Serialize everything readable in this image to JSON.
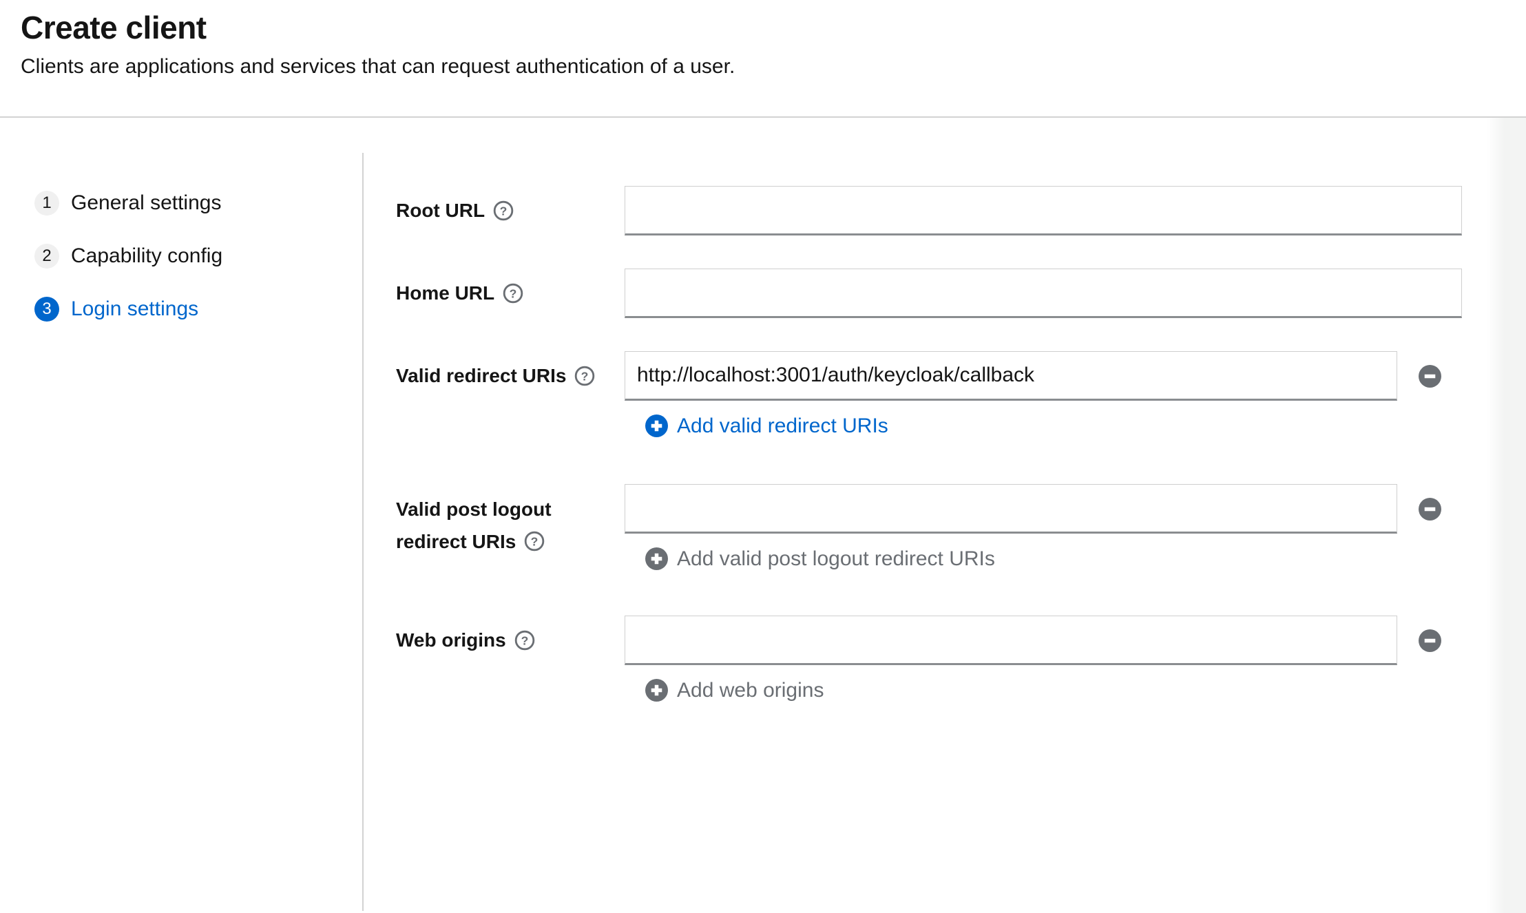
{
  "header": {
    "title": "Create client",
    "subtitle": "Clients are applications and services that can request authentication of a user."
  },
  "wizard": {
    "steps": [
      {
        "number": "1",
        "label": "General settings",
        "active": false
      },
      {
        "number": "2",
        "label": "Capability config",
        "active": false
      },
      {
        "number": "3",
        "label": "Login settings",
        "active": true
      }
    ]
  },
  "form": {
    "fields": [
      {
        "label": "Root URL",
        "help_icon": "question-circle-icon",
        "value": "",
        "placeholder": ""
      },
      {
        "label": "Home URL",
        "help_icon": "question-circle-icon",
        "value": "",
        "placeholder": ""
      },
      {
        "label": "Valid redirect URIs",
        "help_icon": "question-circle-icon",
        "value": "http://localhost:3001/auth/keycloak/callback",
        "placeholder": "",
        "remove_button": {
          "icon": "minus-circle-icon"
        },
        "add_link": {
          "label": "Add valid redirect URIs",
          "enabled": true,
          "icon": "plus-circle-icon"
        }
      },
      {
        "label": "Valid post logout redirect URIs",
        "label_line1": "Valid post logout",
        "label_line2": "redirect URIs",
        "help_icon": "question-circle-icon",
        "value": "",
        "placeholder": "",
        "remove_button": {
          "icon": "minus-circle-icon"
        },
        "add_link": {
          "label": "Add valid post logout redirect URIs",
          "enabled": false,
          "icon": "plus-circle-icon"
        }
      },
      {
        "label": "Web origins",
        "help_icon": "question-circle-icon",
        "value": "",
        "placeholder": "",
        "remove_button": {
          "icon": "minus-circle-icon"
        },
        "add_link": {
          "label": "Add web origins",
          "enabled": false,
          "icon": "plus-circle-icon"
        }
      }
    ]
  },
  "colors": {
    "accent_blue": "#0066cc",
    "icon_gray": "#6a6e73",
    "divider_gray": "#d2d2d2",
    "step_circle_bg": "#f0f0f0",
    "input_bottom_border": "#8a8d90"
  }
}
